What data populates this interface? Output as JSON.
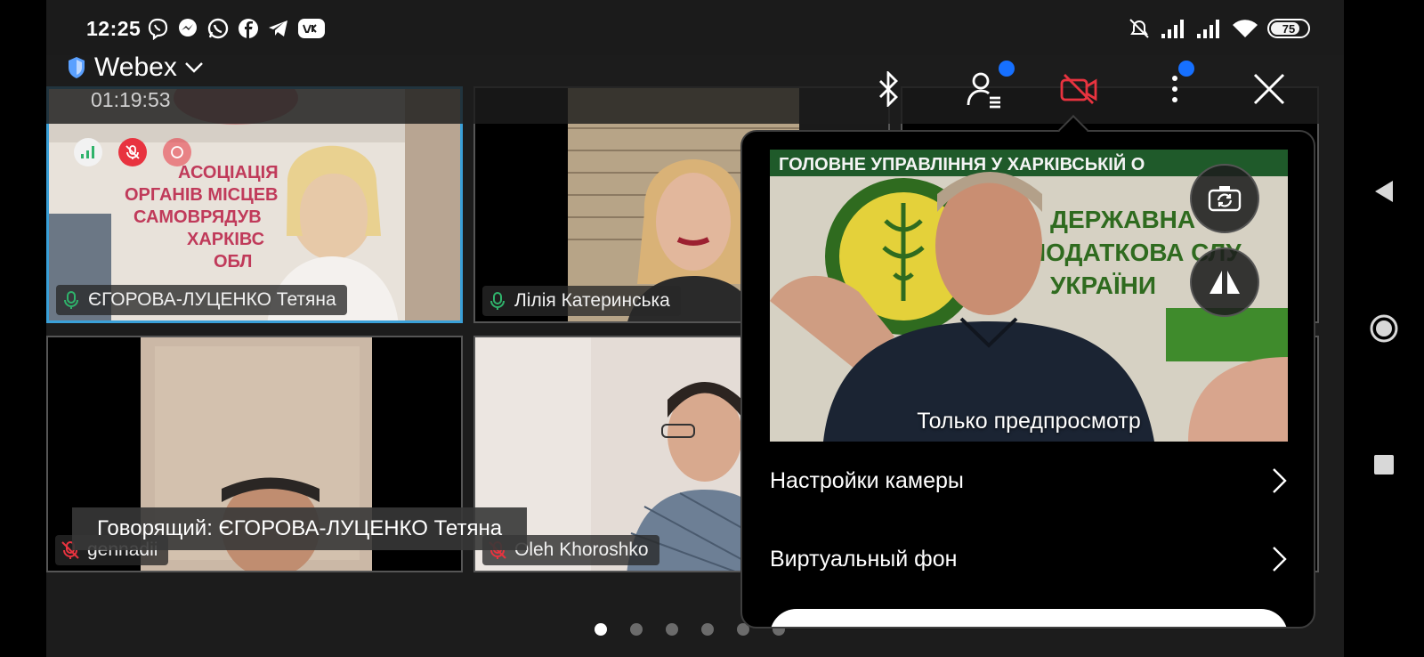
{
  "status_bar": {
    "time": "12:25",
    "notification_icons": [
      "viber-icon",
      "messenger-icon",
      "whatsapp-icon",
      "facebook-icon",
      "telegram-icon",
      "vk-icon"
    ],
    "system_icons": [
      "mute-icon",
      "signal-icon",
      "signal-icon",
      "wifi-icon"
    ],
    "battery": "75"
  },
  "header": {
    "app_name": "Webex",
    "timer": "01:19:53"
  },
  "participants": [
    {
      "name": "ЄГОРОВА-ЛУЦЕНКО Тетяна",
      "mic": "on",
      "active_speaker": true
    },
    {
      "name": "Лілія Катеринська",
      "mic": "on",
      "active_speaker": false
    },
    {
      "name": "gennadii",
      "mic": "muted",
      "active_speaker": false
    },
    {
      "name": "Oleh Khoroshko",
      "mic": "muted",
      "active_speaker": false
    }
  ],
  "speaker_banner": "Говорящий: ЄГОРОВА-ЛУЦЕНКО Тетяна",
  "camera_popup": {
    "preview_label": "Только предпросмотр",
    "preview_sign": [
      "ГОЛОВНЕ УПРАВЛІННЯ У ХАРКІВСЬКІЙ О",
      "ДЕРЖАВНА",
      "ПОДАТКОВА СЛУ",
      "УКРАЇНИ"
    ],
    "menu": [
      {
        "label": "Настройки камеры"
      },
      {
        "label": "Виртуальный фон"
      }
    ]
  },
  "tile1_sign": [
    "АСОЦІАЦІЯ",
    "ОРГАНІВ МІСЦЕВ",
    "САМОВРЯДУВ",
    "ХАРКІВС",
    "ОБЛ"
  ],
  "pagination": {
    "pages": 6,
    "current": 1
  },
  "colors": {
    "active_border": "#3aa0d8",
    "badge": "#1670ff",
    "camera_off": "#e8333f",
    "mic_on": "#2fb36b",
    "mic_muted": "#e8333f"
  }
}
